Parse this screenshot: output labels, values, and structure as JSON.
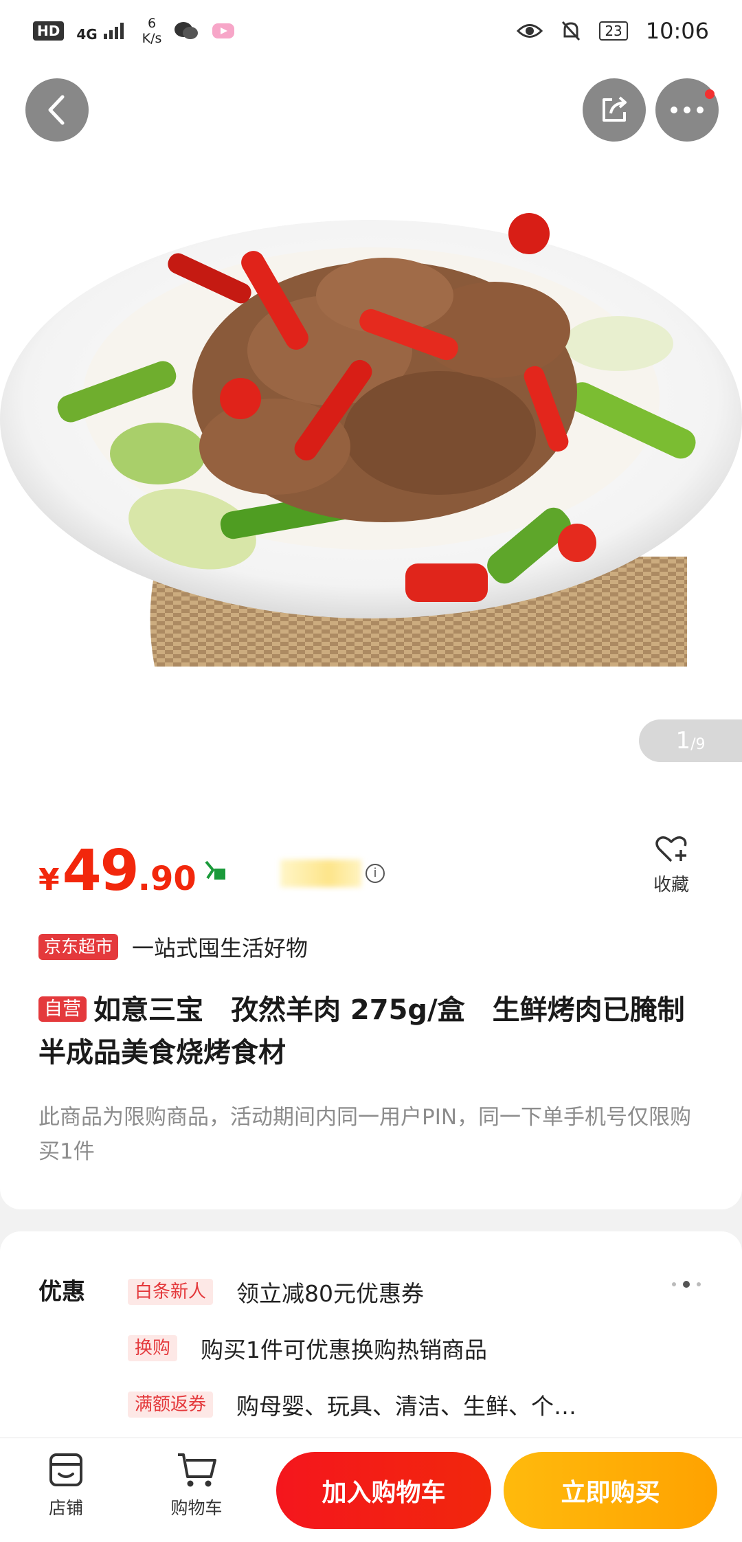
{
  "status_bar": {
    "hd": "HD",
    "network": "4G",
    "net_speed_value": "6",
    "net_speed_unit": "K/s",
    "battery": "23",
    "time": "10:06"
  },
  "gallery": {
    "current": "1",
    "total": "/9"
  },
  "product": {
    "price_symbol": "¥",
    "price_integer": "49",
    "price_decimal": ".90",
    "favorite_label": "收藏",
    "store_tag": "京东超市",
    "store_slogan": "一站式囤生活好物",
    "self_op_tag": "自营",
    "title": "如意三宝　孜然羊肉 275g/盒　生鲜烤肉已腌制半成品美食烧烤食材",
    "limit_note": "此商品为限购商品，活动期间内同一用户PIN，同一下单手机号仅限购买1件"
  },
  "promotions": {
    "label": "优惠",
    "items": [
      {
        "tag": "白条新人",
        "text": "领立减80元优惠券"
      },
      {
        "tag": "换购",
        "text": "购买1件可优惠换购热销商品"
      },
      {
        "tag": "满额返券",
        "text": "购母婴、玩具、清洁、生鲜、个…"
      }
    ]
  },
  "bottom_bar": {
    "store_label": "店铺",
    "cart_label": "购物车",
    "add_to_cart": "加入购物车",
    "buy_now": "立即购买"
  },
  "colors": {
    "price_red": "#f2270c",
    "cart_red": "#f4161d",
    "buy_orange": "#ffa200"
  }
}
